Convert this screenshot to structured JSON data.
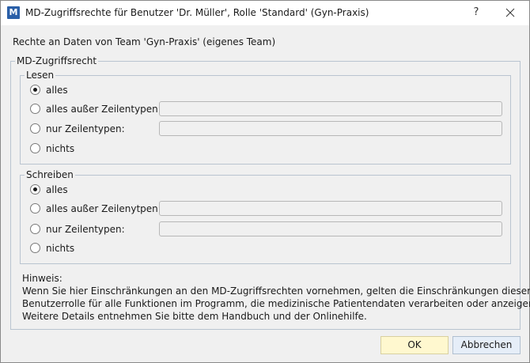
{
  "window": {
    "title": "MD-Zugriffsrechte für Benutzer 'Dr. Müller', Rolle 'Standard' (Gyn-Praxis)",
    "app_icon_letter": "M",
    "help_label": "?"
  },
  "subtitle": "Rechte an Daten von Team 'Gyn-Praxis' (eigenes Team)",
  "access_group": {
    "legend": "MD-Zugriffsrecht",
    "read": {
      "legend": "Lesen",
      "options": [
        {
          "label": "alles",
          "selected": true
        },
        {
          "label": "alles außer Zeilentypen:",
          "selected": false
        },
        {
          "label": "nur Zeilentypen:",
          "selected": false
        },
        {
          "label": "nichts",
          "selected": false
        }
      ],
      "except_value": "",
      "only_value": ""
    },
    "write": {
      "legend": "Schreiben",
      "options": [
        {
          "label": "alles",
          "selected": true
        },
        {
          "label": "alles außer Zeilenytpen:",
          "selected": false
        },
        {
          "label": "nur Zeilentypen:",
          "selected": false
        },
        {
          "label": "nichts",
          "selected": false
        }
      ],
      "except_value": "",
      "only_value": ""
    },
    "hint": {
      "heading": "Hinweis:",
      "lines": [
        "Wenn Sie hier Einschränkungen an den  MD-Zugriffsrechten vornehmen, gelten die Einschränkungen dieser",
        "Benutzerrolle für alle Funktionen im Programm, die medizinische Patientendaten verarbeiten oder anzeigen.",
        "Weitere Details entnehmen Sie bitte dem Handbuch und der Onlinehilfe."
      ]
    }
  },
  "buttons": {
    "ok": "OK",
    "cancel": "Abbrechen"
  },
  "colors": {
    "ok_background": "#fff8cf",
    "cancel_background": "#e6eef8",
    "app_icon": "#2a5fa8"
  }
}
